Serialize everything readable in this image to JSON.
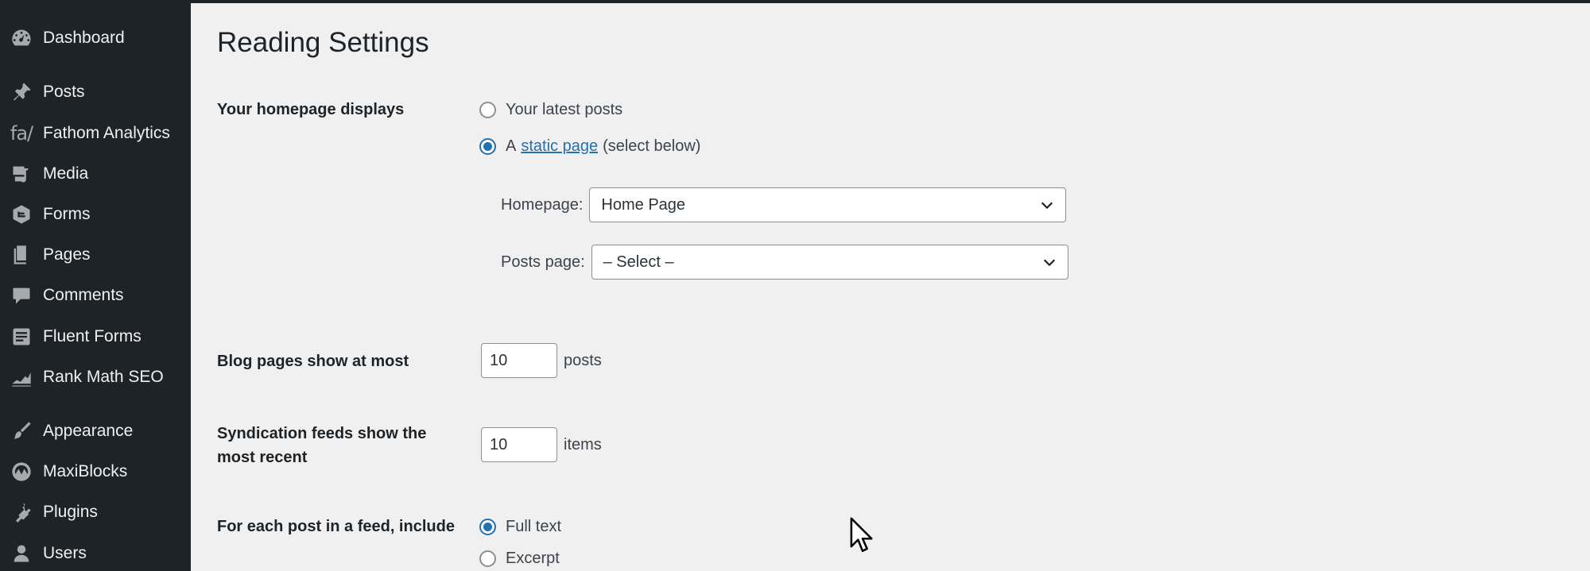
{
  "sidebar": {
    "items": [
      {
        "label": "Dashboard",
        "icon": "dashboard-icon"
      },
      {
        "label": "Posts",
        "icon": "pin-icon"
      },
      {
        "label": "Fathom Analytics",
        "icon": "fathom-icon",
        "icon_text": "fa/"
      },
      {
        "label": "Media",
        "icon": "media-icon"
      },
      {
        "label": "Forms",
        "icon": "forms-icon"
      },
      {
        "label": "Pages",
        "icon": "pages-icon"
      },
      {
        "label": "Comments",
        "icon": "comments-icon"
      },
      {
        "label": "Fluent Forms",
        "icon": "fluent-forms-icon"
      },
      {
        "label": "Rank Math SEO",
        "icon": "rank-math-icon"
      },
      {
        "label": "Appearance",
        "icon": "appearance-icon"
      },
      {
        "label": "MaxiBlocks",
        "icon": "maxiblocks-icon"
      },
      {
        "label": "Plugins",
        "icon": "plugins-icon"
      },
      {
        "label": "Users",
        "icon": "users-icon"
      }
    ]
  },
  "page": {
    "title": "Reading Settings"
  },
  "homepage_displays": {
    "label": "Your homepage displays",
    "option_latest": "Your latest posts",
    "option_static_prefix": "A",
    "option_static_link": "static page",
    "option_static_suffix": "(select below)",
    "selected": "static",
    "homepage_label": "Homepage:",
    "homepage_value": "Home Page",
    "posts_page_label": "Posts page:",
    "posts_page_value": "– Select –"
  },
  "blog_pages": {
    "label": "Blog pages show at most",
    "value": "10",
    "unit": "posts"
  },
  "syndication": {
    "label": "Syndication feeds show the most recent",
    "value": "10",
    "unit": "items"
  },
  "feed_include": {
    "label": "For each post in a feed, include",
    "option_full": "Full text",
    "option_excerpt": "Excerpt",
    "selected": "full"
  },
  "colors": {
    "sidebar_bg": "#1d2327",
    "content_bg": "#f0f0f1",
    "accent": "#2271b1"
  }
}
